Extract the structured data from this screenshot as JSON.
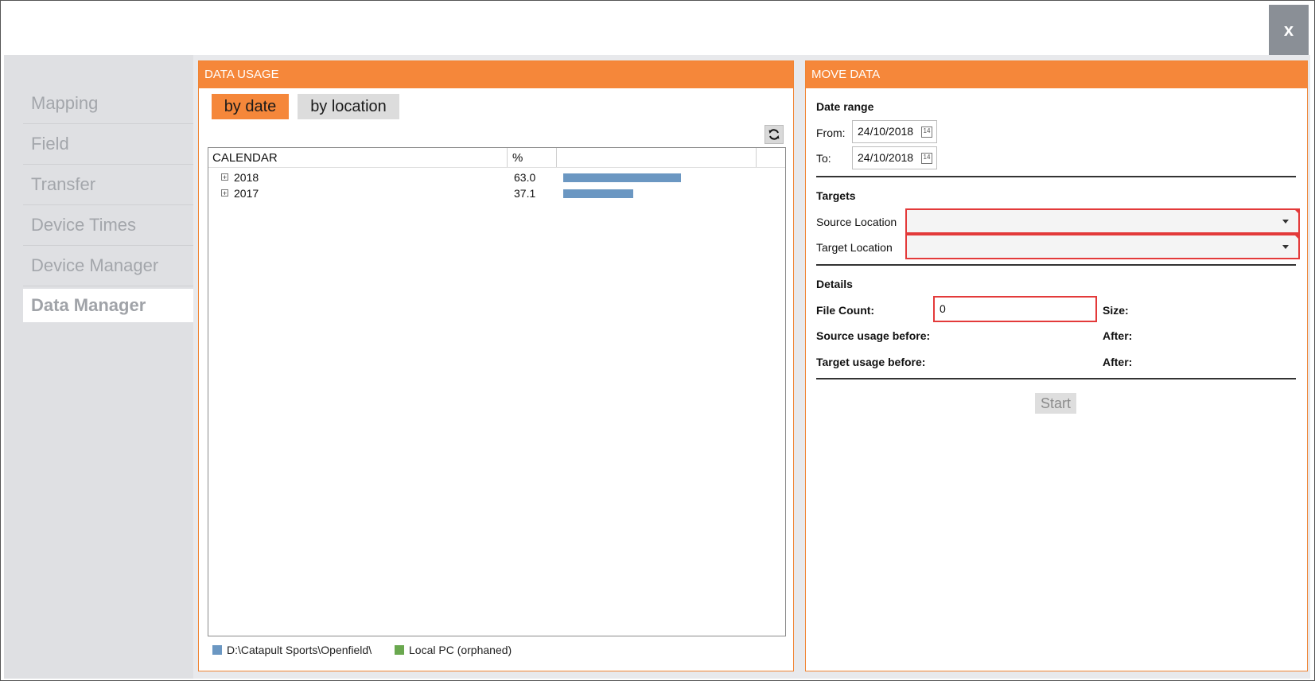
{
  "window": {
    "close_label": "x"
  },
  "sidebar": {
    "items": [
      {
        "label": "Mapping"
      },
      {
        "label": "Field"
      },
      {
        "label": "Transfer"
      },
      {
        "label": "Device Times"
      },
      {
        "label": "Device Manager"
      },
      {
        "label": "Data Manager",
        "active": true
      }
    ]
  },
  "data_usage": {
    "header": "DATA USAGE",
    "tabs": [
      {
        "label": "by date",
        "active": true
      },
      {
        "label": "by location",
        "active": false
      }
    ],
    "columns": [
      "CALENDAR",
      "%"
    ],
    "rows": [
      {
        "year": "2018",
        "percent": "63.0"
      },
      {
        "year": "2017",
        "percent": "37.1"
      }
    ],
    "legend": [
      {
        "label": "D:\\Catapult Sports\\Openfield\\",
        "color": "#6b97c2"
      },
      {
        "label": "Local PC (orphaned)",
        "color": "#6aa84f"
      }
    ]
  },
  "move_data": {
    "header": "MOVE DATA",
    "date_range": {
      "title": "Date range",
      "from_label": "From:",
      "from_value": "24/10/2018",
      "to_label": "To:",
      "to_value": "24/10/2018"
    },
    "targets": {
      "title": "Targets",
      "source_label": "Source Location",
      "target_label": "Target Location"
    },
    "details": {
      "title": "Details",
      "file_count_label": "File Count:",
      "file_count_value": "0",
      "size_label": "Size:",
      "source_before_label": "Source usage before:",
      "source_after_label": "After:",
      "target_before_label": "Target usage before:",
      "target_after_label": "After:"
    },
    "start_label": "Start"
  }
}
